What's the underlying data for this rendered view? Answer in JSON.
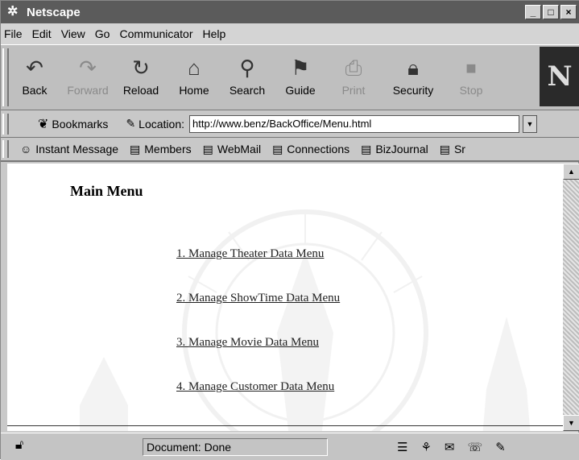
{
  "window": {
    "title": "Netscape"
  },
  "menubar": {
    "items": [
      {
        "label": "File"
      },
      {
        "label": "Edit"
      },
      {
        "label": "View"
      },
      {
        "label": "Go"
      },
      {
        "label": "Communicator"
      },
      {
        "label": "Help"
      }
    ]
  },
  "toolbar": {
    "buttons": [
      {
        "label": "Back",
        "icon": "back-icon",
        "enabled": true
      },
      {
        "label": "Forward",
        "icon": "forward-icon",
        "enabled": false
      },
      {
        "label": "Reload",
        "icon": "reload-icon",
        "enabled": true
      },
      {
        "label": "Home",
        "icon": "home-icon",
        "enabled": true
      },
      {
        "label": "Search",
        "icon": "search-icon",
        "enabled": true
      },
      {
        "label": "Guide",
        "icon": "guide-icon",
        "enabled": true
      },
      {
        "label": "Print",
        "icon": "print-icon",
        "enabled": false
      },
      {
        "label": "Security",
        "icon": "security-icon",
        "enabled": true
      },
      {
        "label": "Stop",
        "icon": "stop-icon",
        "enabled": false
      }
    ],
    "brand": "N"
  },
  "locationbar": {
    "bookmarks_label": "Bookmarks",
    "location_label": "Location:",
    "url": "http://www.benz/BackOffice/Menu.html"
  },
  "personal_toolbar": {
    "items": [
      {
        "label": "Instant Message"
      },
      {
        "label": "Members"
      },
      {
        "label": "WebMail"
      },
      {
        "label": "Connections"
      },
      {
        "label": "BizJournal"
      },
      {
        "label": "Sr"
      }
    ]
  },
  "page": {
    "title": "Main Menu",
    "links": [
      {
        "label": "1. Manage Theater Data Menu"
      },
      {
        "label": "2. Manage ShowTime Data Menu"
      },
      {
        "label": "3. Manage Movie Data Menu"
      },
      {
        "label": "4. Manage Customer Data Menu"
      }
    ]
  },
  "statusbar": {
    "text": "Document: Done"
  },
  "colors": {
    "titlebar": "#5b5b5b",
    "chrome": "#c8c8c8",
    "content": "#ffffff"
  }
}
